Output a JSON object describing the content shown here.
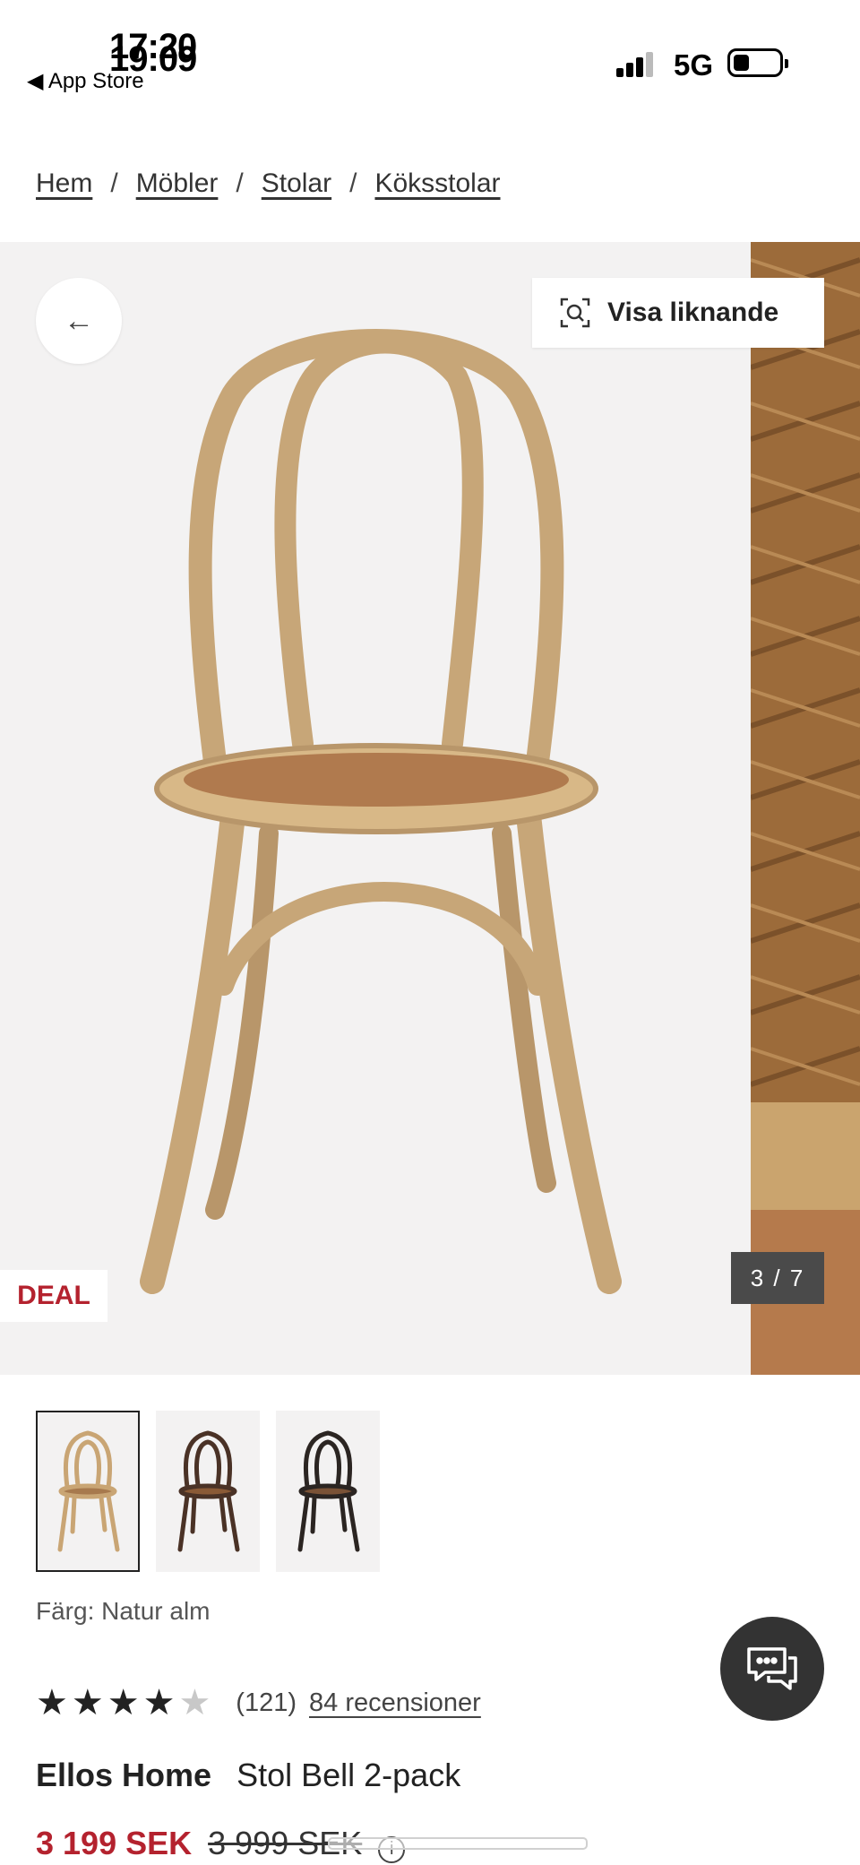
{
  "status_bar": {
    "time_back": "17:20",
    "time_front": "19:09",
    "back_app_label": "App Store",
    "network": "5G"
  },
  "breadcrumb": [
    "Hem",
    "Möbler",
    "Stolar",
    "Köksstolar"
  ],
  "gallery": {
    "similar_label": "Visa liknande",
    "deal_badge": "DEAL",
    "counter": "3 / 7"
  },
  "product": {
    "color_label": "Färg: Natur alm",
    "rating_stars": 4,
    "rating_max": 5,
    "rating_count": "(121)",
    "reviews_link": "84 recensioner",
    "brand": "Ellos Home",
    "name": "Stol Bell 2-pack",
    "price_now": "3 199 SEK",
    "price_was": "3 999 SEK"
  },
  "thumbnails": [
    {
      "name": "natural",
      "color": "#c9a574"
    },
    {
      "name": "brown",
      "color": "#4a3226"
    },
    {
      "name": "black",
      "color": "#2b2522"
    }
  ],
  "colors": {
    "accent_red": "#b4222e",
    "text_dark": "#222222",
    "image_bg": "#f3f2f2"
  }
}
